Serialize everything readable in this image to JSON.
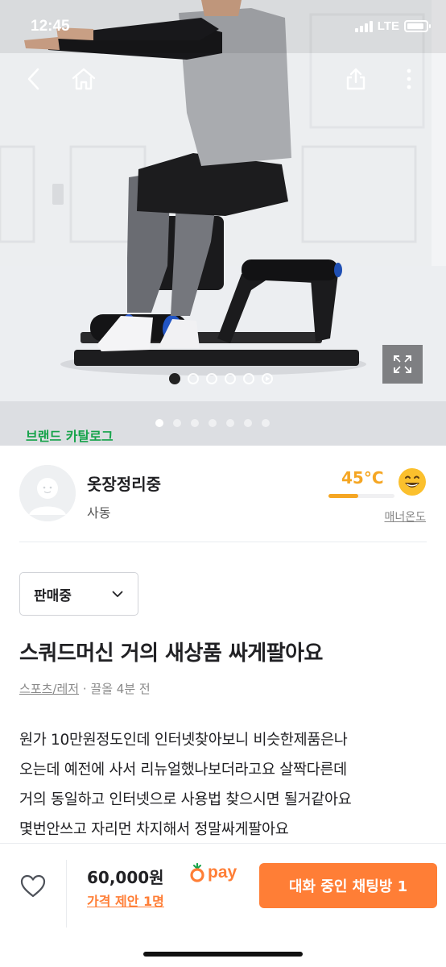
{
  "status_bar": {
    "time": "12:45",
    "network": "LTE"
  },
  "nav": {
    "back_icon": "chevron-left-icon",
    "home_icon": "home-icon",
    "share_icon": "share-icon",
    "more_icon": "more-vertical-icon"
  },
  "gallery": {
    "image_count": 5,
    "active_index": 0,
    "has_video": true,
    "expand_icon": "expand-icon"
  },
  "brand_catalog": {
    "label": "브랜드 카탈로그",
    "pages": 7,
    "active_page": 0
  },
  "seller": {
    "name": "옷장정리중",
    "location": "사동",
    "temperature": "45°C",
    "temperature_value": 45,
    "manner_label": "매너온도"
  },
  "listing": {
    "status": "판매중",
    "title": "스쿼드머신 거의 새상품 싸게팔아요",
    "category": "스포츠/레저",
    "meta_separator": "·",
    "bumped": "끌올 4분 전",
    "description_lines": [
      "원가 10만원정도인데 인터넷찾아보니 비슷한제품은나",
      "오는데 예전에 사서 리뉴얼했나보더라고요 살짝다른데",
      "거의 동일하고 인터넷으로 사용법 찾으시면 될거같아요",
      "몇번안쓰고 자리먼 차지해서 정말싸게팔아요"
    ]
  },
  "bottom_bar": {
    "price": "60,000원",
    "offer": "가격 제안 1명",
    "pay_label": "pay",
    "chat_button": "대화 중인 채팅방 1"
  },
  "colors": {
    "accent": "#ff7e36",
    "temperature": "#f5a623",
    "brand_green": "#16a34a"
  }
}
